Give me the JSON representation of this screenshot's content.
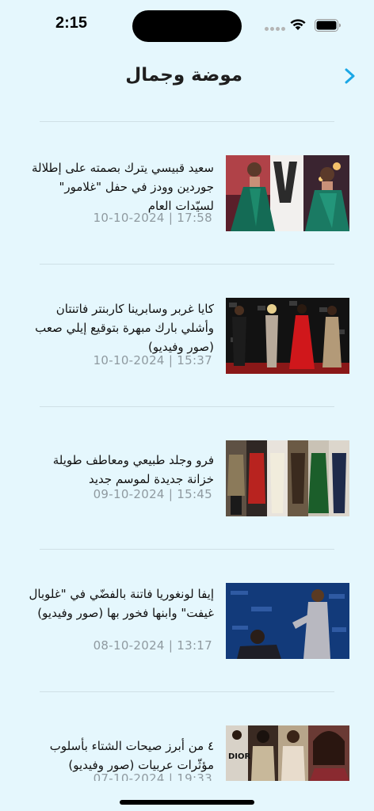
{
  "status": {
    "time": "2:15"
  },
  "header": {
    "title": "موضة وجمال",
    "back_icon": "chevron-right-icon",
    "accent": "#1aa7e6"
  },
  "articles": [
    {
      "headline": "سعيد قبيسي يترك بصمته على إطلالة جوردين وودز في حفل \"غلامور\" لسيّدات العام",
      "time": "17:58",
      "date": "10-10-2024"
    },
    {
      "headline": "كايا غربر وسابرينا كاربنتر فاتنتان وأشلي بارك مبهرة بتوقيع إيلي صعب (صور وفيديو)",
      "time": "15:37",
      "date": "10-10-2024"
    },
    {
      "headline": "فرو وجلد طبيعي ومعاطف طويلة خزانة جديدة لموسم جديد",
      "time": "15:45",
      "date": "09-10-2024"
    },
    {
      "headline": "إيفا لونغوريا فاتنة بالفضّي في \"غلوبال غيفت\" وابنها فخور بها (صور وفيديو)",
      "time": "13:17",
      "date": "08-10-2024"
    },
    {
      "headline": "٤ من أبرز صيحات الشتاء بأسلوب مؤثّرات عربيات (صور وفيديو)",
      "time": "19:33",
      "date": "07-10-2024"
    }
  ]
}
